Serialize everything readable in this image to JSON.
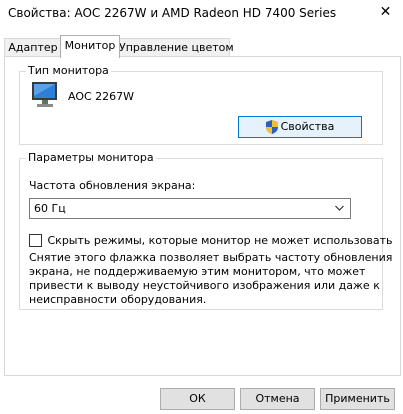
{
  "window": {
    "title": "Свойства: AOC 2267W и AMD Radeon HD 7400 Series",
    "close_glyph": "✕"
  },
  "tabs": [
    {
      "label": "Адаптер",
      "active": false
    },
    {
      "label": "Монитор",
      "active": true
    },
    {
      "label": "Управление цветом",
      "active": false
    }
  ],
  "monitor_type": {
    "group_title": "Тип монитора",
    "monitor_name": "AOC 2267W",
    "properties_button": "Свойства",
    "icons": [
      "monitor-icon",
      "uac-shield-icon"
    ]
  },
  "monitor_settings": {
    "group_title": "Параметры монитора",
    "refresh_label": "Частота обновления экрана:",
    "refresh_value": "60 Гц",
    "hide_modes_label": "Скрыть режимы, которые монитор не может использовать",
    "hide_modes_checked": false,
    "description_lines": [
      "Снятие этого флажка позволяет выбрать частоту обновления",
      "экрана, не поддерживаемую этим монитором, что может",
      "привести к выводу неустойчивого изображения или даже к",
      "неисправности оборудования."
    ]
  },
  "footer": {
    "ok": "ОК",
    "cancel": "Отмена",
    "apply": "Применить"
  }
}
